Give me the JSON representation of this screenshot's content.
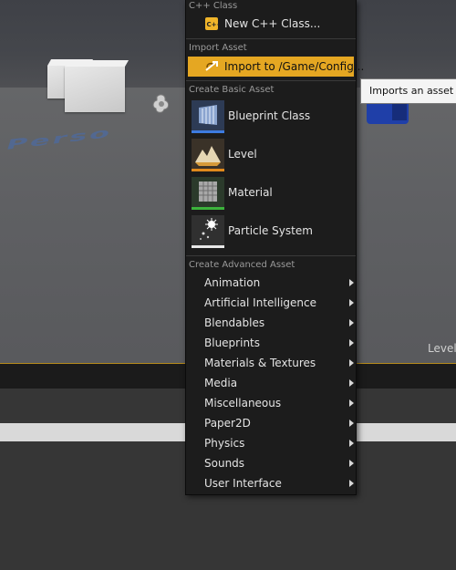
{
  "viewport": {
    "overlay_text": "Perso",
    "level_label": "Level:"
  },
  "menu": {
    "sections": {
      "cpp": {
        "header": "C++ Class",
        "new_class_label": "New C++ Class..."
      },
      "import": {
        "header": "Import Asset",
        "import_label": "Import to /Game/Config..."
      },
      "basic": {
        "header": "Create Basic Asset",
        "assets": [
          {
            "label": "Blueprint Class",
            "accent": "#3d7be0"
          },
          {
            "label": "Level",
            "accent": "#e0891c"
          },
          {
            "label": "Material",
            "accent": "#3cb43c"
          },
          {
            "label": "Particle System",
            "accent": "#e8e8e8"
          }
        ]
      },
      "advanced": {
        "header": "Create Advanced Asset",
        "submenus": [
          "Animation",
          "Artificial Intelligence",
          "Blendables",
          "Blueprints",
          "Materials & Textures",
          "Media",
          "Miscellaneous",
          "Paper2D",
          "Physics",
          "Sounds",
          "User Interface"
        ]
      }
    },
    "highlight_color": "#e5a722"
  },
  "tooltip": {
    "text": "Imports an asset fr"
  }
}
